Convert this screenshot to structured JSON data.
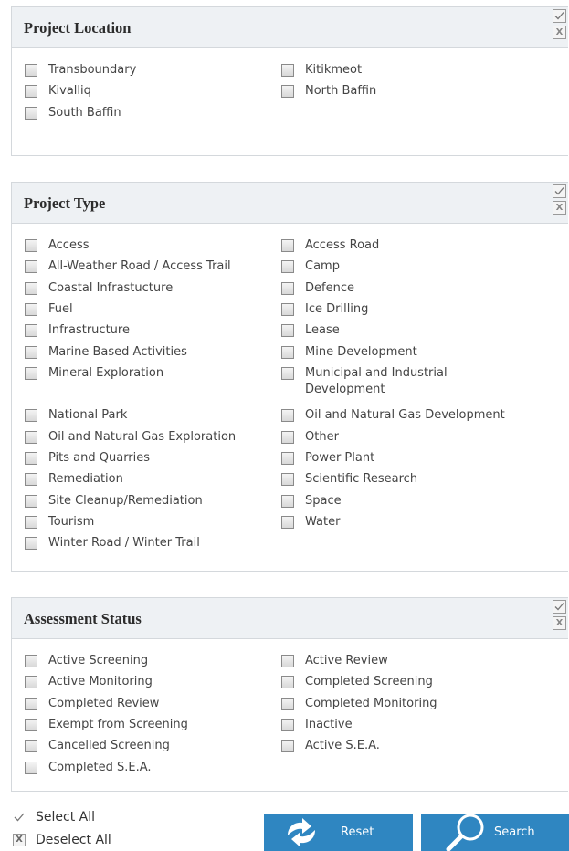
{
  "sections": [
    {
      "title": "Project Location",
      "col1": [
        "Transboundary",
        "Kivalliq",
        "South Baffin"
      ],
      "col2": [
        "Kitikmeot",
        "North Baffin"
      ]
    },
    {
      "title": "Project Type",
      "col1": [
        "Access",
        "All-Weather Road / Access Trail",
        "Coastal Infrastucture",
        "Fuel",
        "Infrastructure",
        "Marine Based Activities",
        "Mineral Exploration",
        "National Park",
        "Oil and Natural Gas Exploration",
        "Pits and Quarries",
        "Remediation",
        "Site Cleanup/Remediation",
        "Tourism",
        "Winter Road / Winter Trail"
      ],
      "col2": [
        "Access Road",
        "Camp",
        "Defence",
        "Ice Drilling",
        "Lease",
        "Mine Development",
        "Municipal and Industrial Development",
        "Oil and Natural Gas Development",
        "Other",
        "Power Plant",
        "Scientific Research",
        "Space",
        "Water"
      ]
    },
    {
      "title": "Assessment Status",
      "col1": [
        "Active Screening",
        "Active Monitoring",
        "Completed Review",
        "Exempt from Screening",
        "Cancelled Screening",
        "Completed S.E.A."
      ],
      "col2": [
        "Active Review",
        "Completed Screening",
        "Completed Monitoring",
        "Inactive",
        "Active S.E.A."
      ]
    }
  ],
  "header_icons": {
    "check": "check-icon",
    "x": "X"
  },
  "bulk": {
    "select_all": "Select All",
    "deselect_all": "Deselect All",
    "x_glyph": "X"
  },
  "buttons": {
    "reset": "Reset",
    "search": "Search"
  },
  "colors": {
    "button": "#2f86c1",
    "header_bg": "#eef1f4"
  }
}
